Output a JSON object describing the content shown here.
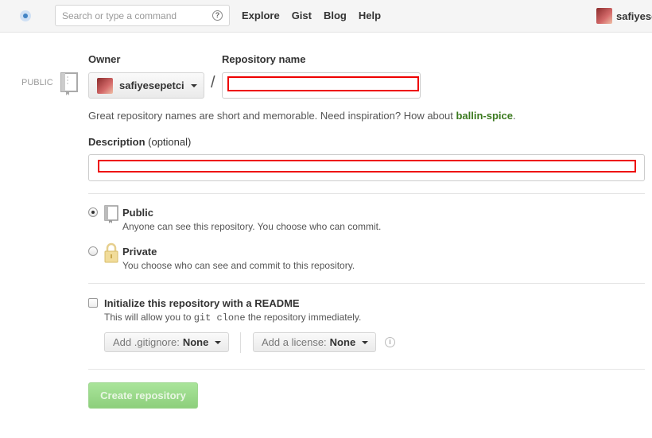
{
  "header": {
    "search_placeholder": "Search or type a command",
    "search_help": "?",
    "nav": [
      "Explore",
      "Gist",
      "Blog",
      "Help"
    ],
    "username": "safiyesepetci"
  },
  "form": {
    "owner_label": "Owner",
    "repo_name_label": "Repository name",
    "public_tag": "PUBLIC",
    "owner_value": "safiyesepetci",
    "slash": "/",
    "hint_prefix": "Great repository names are short and memorable. Need inspiration? How about ",
    "hint_suggestion": "ballin-spice",
    "hint_suffix": ".",
    "description_label": "Description",
    "description_optional": "(optional)",
    "visibility": {
      "public_title": "Public",
      "public_desc": "Anyone can see this repository. You choose who can commit.",
      "private_title": "Private",
      "private_desc": "You choose who can see and commit to this repository.",
      "selected": "public"
    },
    "readme": {
      "title": "Initialize this repository with a README",
      "desc_prefix": "This will allow you to ",
      "desc_code": "git clone",
      "desc_suffix": " the repository immediately.",
      "checked": false
    },
    "gitignore": {
      "prefix": "Add .gitignore:",
      "value": "None"
    },
    "license": {
      "prefix": "Add a license:",
      "value": "None"
    },
    "info_icon": "i",
    "submit_label": "Create repository"
  },
  "colors": {
    "highlight_box": "#ee0000",
    "suggestion": "#3b7a1f",
    "create_button": "#95d585"
  }
}
